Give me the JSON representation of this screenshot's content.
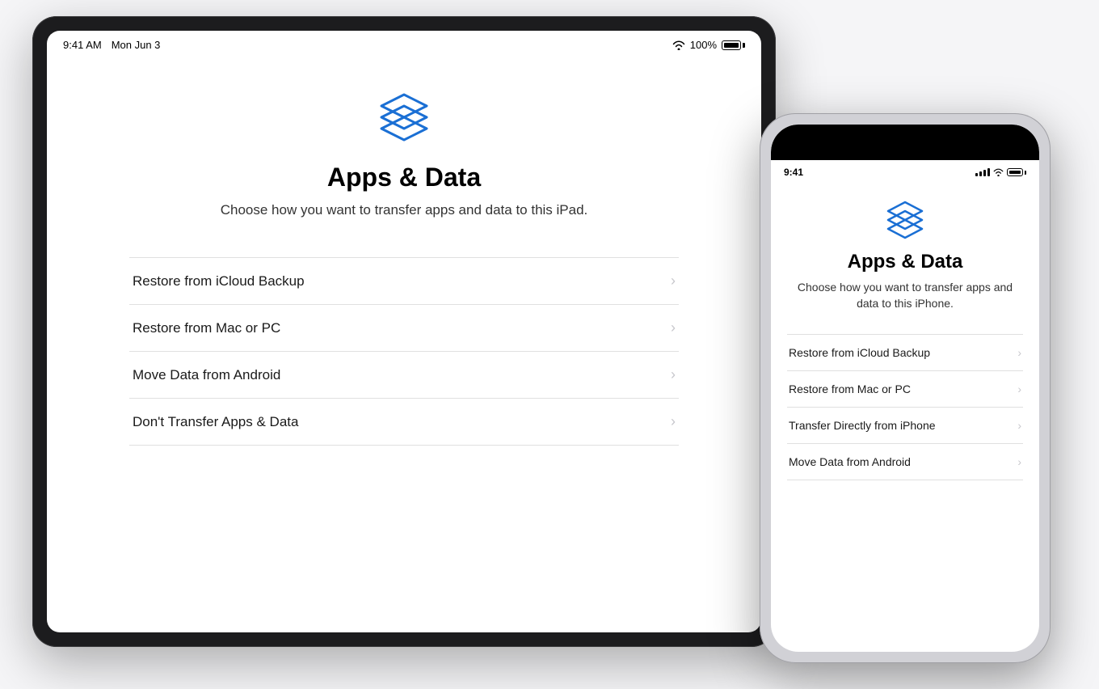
{
  "scene": {
    "background_color": "#f5f5f7"
  },
  "ipad": {
    "status_bar": {
      "time": "9:41 AM",
      "date": "Mon Jun 3",
      "battery_percent": "100%"
    },
    "screen": {
      "title": "Apps & Data",
      "subtitle": "Choose how you want to transfer apps and data to this iPad.",
      "options": [
        {
          "label": "Restore from iCloud Backup"
        },
        {
          "label": "Restore from Mac or PC"
        },
        {
          "label": "Move Data from Android"
        },
        {
          "label": "Don't Transfer Apps & Data"
        }
      ]
    }
  },
  "iphone": {
    "status_bar": {
      "time": "9:41"
    },
    "screen": {
      "title": "Apps & Data",
      "subtitle": "Choose how you want to transfer apps and data to this iPhone.",
      "options": [
        {
          "label": "Restore from iCloud Backup"
        },
        {
          "label": "Restore from Mac or PC"
        },
        {
          "label": "Transfer Directly from iPhone"
        },
        {
          "label": "Move Data from Android"
        }
      ]
    }
  },
  "icons": {
    "stack_color": "#1a6fd4",
    "chevron": "›"
  }
}
